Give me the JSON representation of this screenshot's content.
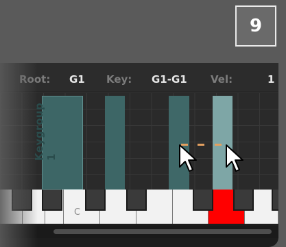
{
  "step_badge": "9",
  "header": {
    "root_label": "Root:",
    "root_value": "G1",
    "key_label": "Key:",
    "key_value": "G1-G1",
    "vel_label": "Vel:",
    "vel_value": "1 -"
  },
  "keygroup_label": "Keygroup 1",
  "keyboard": {
    "c_label": "C"
  },
  "colors": {
    "keygroup_fill": "#3d6666",
    "selected_column": "#3f6868",
    "hover_column": "#7ea6a6",
    "pressed_key": "#ff0000",
    "drag_marker": "#e3a060"
  },
  "icons": [
    "mouse-pointer-icon",
    "mouse-pointer-icon"
  ]
}
